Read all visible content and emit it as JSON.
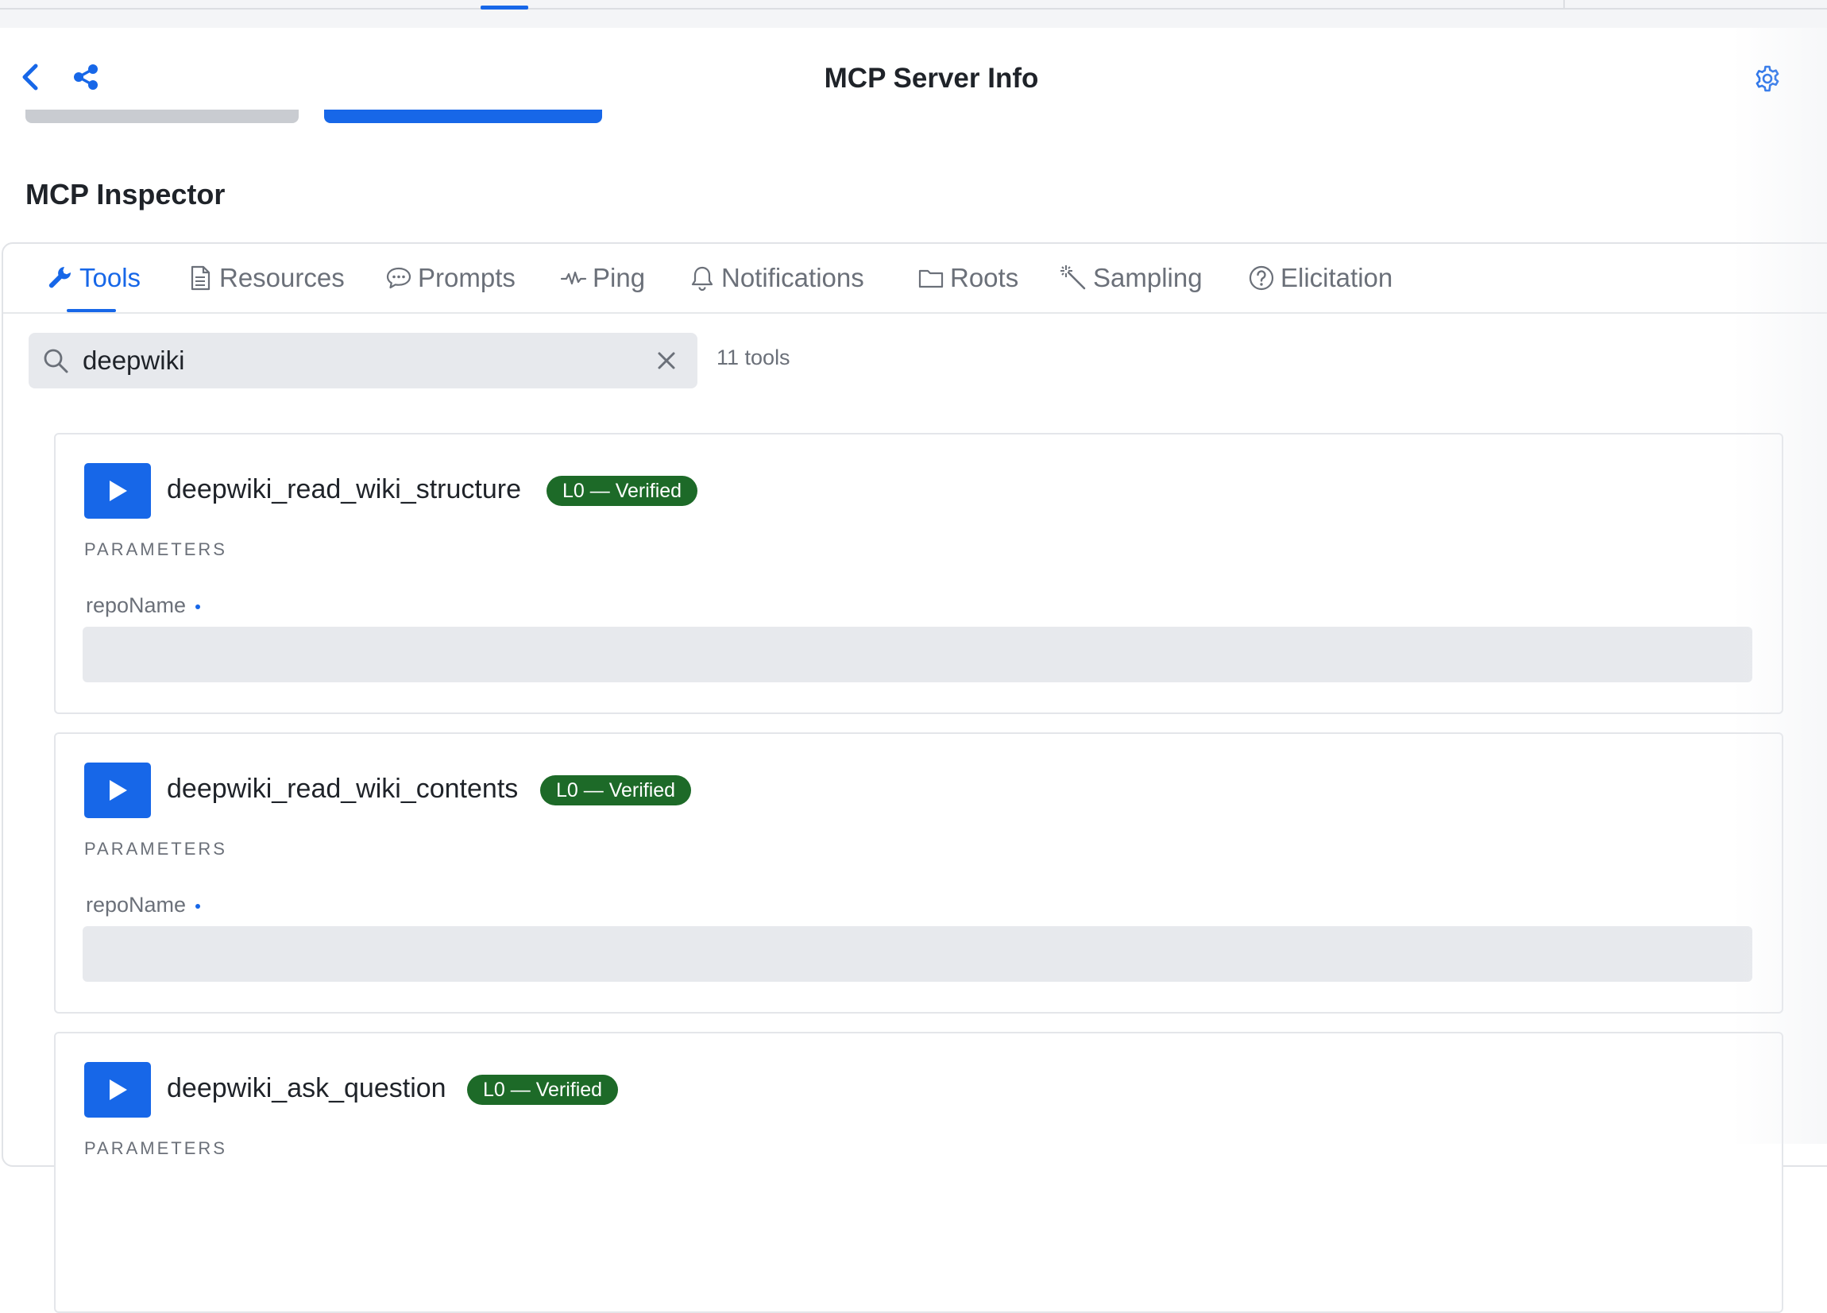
{
  "colors": {
    "accent": "#1767e8",
    "badge_green": "#1d6a28",
    "text_primary": "#1f2329",
    "text_secondary": "#6b7079",
    "field_bg": "#e7e9ed"
  },
  "nav": {
    "title": "MCP Server Info",
    "back_icon": "chevron-left-icon",
    "share_icon": "share-icon",
    "settings_icon": "gear-icon"
  },
  "section": {
    "title": "MCP Inspector"
  },
  "tabs": [
    {
      "label": "Tools",
      "icon": "wrench-icon",
      "active": true
    },
    {
      "label": "Resources",
      "icon": "document-icon",
      "active": false
    },
    {
      "label": "Prompts",
      "icon": "chat-bubble-icon",
      "active": false
    },
    {
      "label": "Ping",
      "icon": "pulse-icon",
      "active": false
    },
    {
      "label": "Notifications",
      "icon": "bell-icon",
      "active": false
    },
    {
      "label": "Roots",
      "icon": "folder-icon",
      "active": false
    },
    {
      "label": "Sampling",
      "icon": "magic-wand-icon",
      "active": false
    },
    {
      "label": "Elicitation",
      "icon": "question-circle-icon",
      "active": false
    }
  ],
  "search": {
    "value": "deepwiki",
    "count_label": "11 tools"
  },
  "tools": [
    {
      "name": "deepwiki_read_wiki_structure",
      "badge": "L0 — Verified",
      "params_heading": "PARAMETERS",
      "params": [
        {
          "name": "repoName",
          "value": ""
        }
      ]
    },
    {
      "name": "deepwiki_read_wiki_contents",
      "badge": "L0 — Verified",
      "params_heading": "PARAMETERS",
      "params": [
        {
          "name": "repoName",
          "value": ""
        }
      ]
    },
    {
      "name": "deepwiki_ask_question",
      "badge": "L0 — Verified",
      "params_heading": "PARAMETERS",
      "params": []
    }
  ]
}
